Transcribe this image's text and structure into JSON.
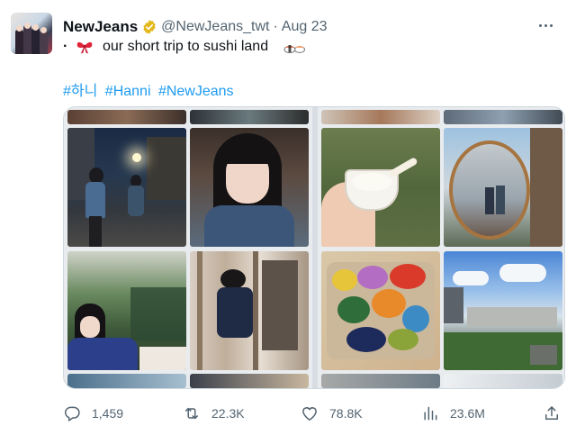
{
  "author": {
    "name": "NewJeans",
    "handle": "@NewJeans_twt",
    "separator": "·",
    "date": "Aug 23"
  },
  "tweet": {
    "bullet": "·",
    "text": "our short trip to sushi land",
    "emoji_start": "ribbon-emoji",
    "emoji_end": "sushi-emoji",
    "hashtags": [
      "#하니",
      "#Hanni",
      "#NewJeans"
    ]
  },
  "media": {
    "image_count": 2,
    "layout": "two side-by-side photo collages"
  },
  "stats": {
    "replies": "1,459",
    "retweets": "22.3K",
    "likes": "78.8K",
    "views": "23.6M"
  },
  "colors": {
    "link": "#1d9bf0",
    "secondary_text": "#536471",
    "verified_badge": "#e2b719"
  }
}
